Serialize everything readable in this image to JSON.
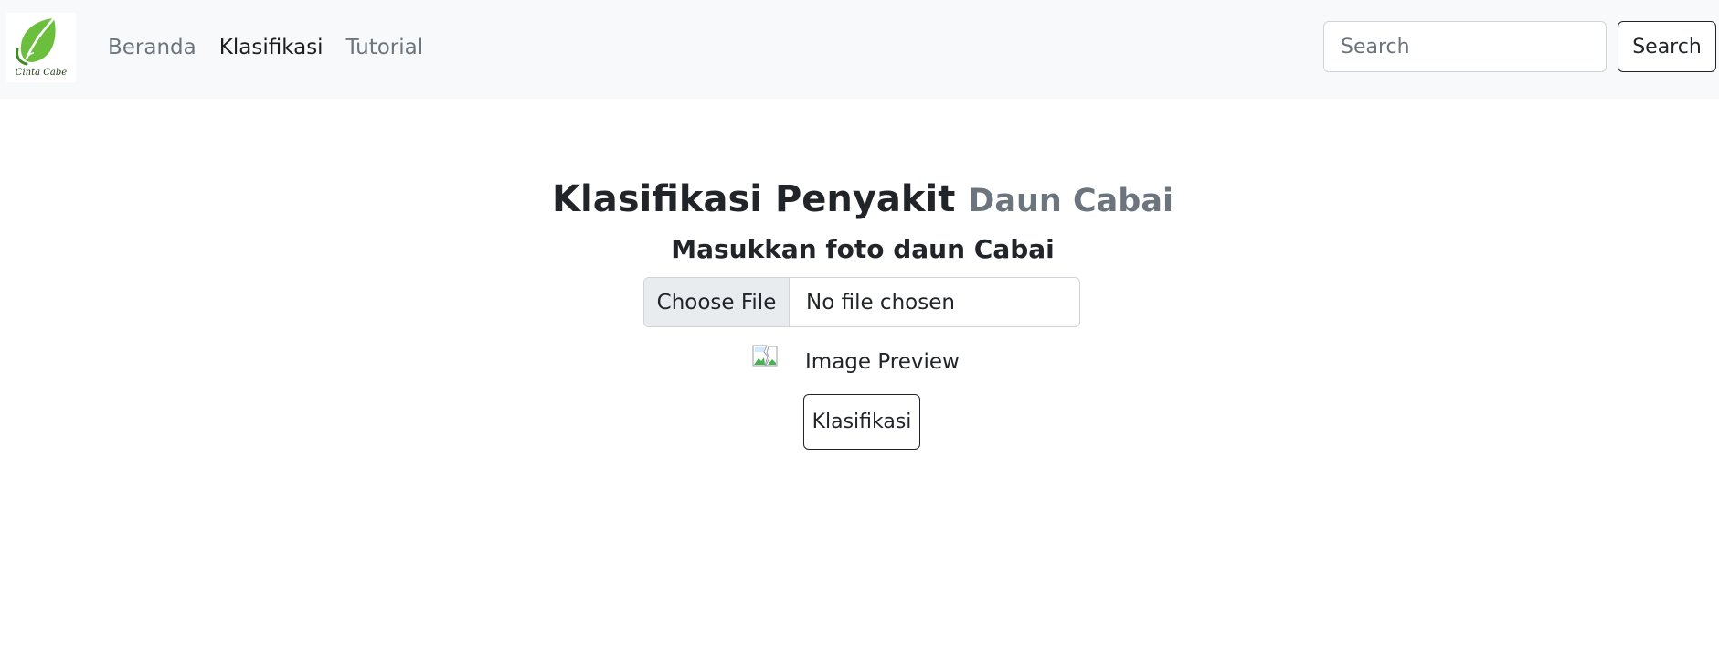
{
  "brand": {
    "logo_text": "Cinta Cabe",
    "logo_color": "#5aa83a"
  },
  "nav": {
    "items": [
      {
        "label": "Beranda",
        "active": false
      },
      {
        "label": "Klasifikasi",
        "active": true
      },
      {
        "label": "Tutorial",
        "active": false
      }
    ]
  },
  "search": {
    "placeholder": "Search",
    "button_label": "Search"
  },
  "main": {
    "title": "Klasifikasi Penyakit",
    "title_muted": "Daun Cabai",
    "subtitle": "Masukkan foto daun Cabai",
    "file_input": {
      "button_label": "Choose File",
      "status": "No file chosen"
    },
    "preview_alt": "Image Preview",
    "classify_button": "Klasifikasi"
  },
  "colors": {
    "navbar_bg": "#f8f9fa",
    "muted_text": "#6c757d",
    "border": "#ced4da",
    "text": "#212529"
  }
}
